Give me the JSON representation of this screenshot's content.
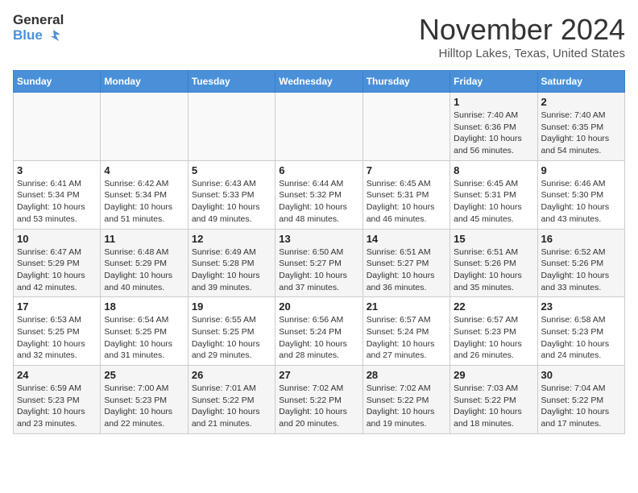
{
  "header": {
    "logo_line1": "General",
    "logo_line2": "Blue",
    "month": "November 2024",
    "location": "Hilltop Lakes, Texas, United States"
  },
  "weekdays": [
    "Sunday",
    "Monday",
    "Tuesday",
    "Wednesday",
    "Thursday",
    "Friday",
    "Saturday"
  ],
  "weeks": [
    [
      {
        "day": "",
        "info": ""
      },
      {
        "day": "",
        "info": ""
      },
      {
        "day": "",
        "info": ""
      },
      {
        "day": "",
        "info": ""
      },
      {
        "day": "",
        "info": ""
      },
      {
        "day": "1",
        "info": "Sunrise: 7:40 AM\nSunset: 6:36 PM\nDaylight: 10 hours and 56 minutes."
      },
      {
        "day": "2",
        "info": "Sunrise: 7:40 AM\nSunset: 6:35 PM\nDaylight: 10 hours and 54 minutes."
      }
    ],
    [
      {
        "day": "3",
        "info": "Sunrise: 6:41 AM\nSunset: 5:34 PM\nDaylight: 10 hours and 53 minutes."
      },
      {
        "day": "4",
        "info": "Sunrise: 6:42 AM\nSunset: 5:34 PM\nDaylight: 10 hours and 51 minutes."
      },
      {
        "day": "5",
        "info": "Sunrise: 6:43 AM\nSunset: 5:33 PM\nDaylight: 10 hours and 49 minutes."
      },
      {
        "day": "6",
        "info": "Sunrise: 6:44 AM\nSunset: 5:32 PM\nDaylight: 10 hours and 48 minutes."
      },
      {
        "day": "7",
        "info": "Sunrise: 6:45 AM\nSunset: 5:31 PM\nDaylight: 10 hours and 46 minutes."
      },
      {
        "day": "8",
        "info": "Sunrise: 6:45 AM\nSunset: 5:31 PM\nDaylight: 10 hours and 45 minutes."
      },
      {
        "day": "9",
        "info": "Sunrise: 6:46 AM\nSunset: 5:30 PM\nDaylight: 10 hours and 43 minutes."
      }
    ],
    [
      {
        "day": "10",
        "info": "Sunrise: 6:47 AM\nSunset: 5:29 PM\nDaylight: 10 hours and 42 minutes."
      },
      {
        "day": "11",
        "info": "Sunrise: 6:48 AM\nSunset: 5:29 PM\nDaylight: 10 hours and 40 minutes."
      },
      {
        "day": "12",
        "info": "Sunrise: 6:49 AM\nSunset: 5:28 PM\nDaylight: 10 hours and 39 minutes."
      },
      {
        "day": "13",
        "info": "Sunrise: 6:50 AM\nSunset: 5:27 PM\nDaylight: 10 hours and 37 minutes."
      },
      {
        "day": "14",
        "info": "Sunrise: 6:51 AM\nSunset: 5:27 PM\nDaylight: 10 hours and 36 minutes."
      },
      {
        "day": "15",
        "info": "Sunrise: 6:51 AM\nSunset: 5:26 PM\nDaylight: 10 hours and 35 minutes."
      },
      {
        "day": "16",
        "info": "Sunrise: 6:52 AM\nSunset: 5:26 PM\nDaylight: 10 hours and 33 minutes."
      }
    ],
    [
      {
        "day": "17",
        "info": "Sunrise: 6:53 AM\nSunset: 5:25 PM\nDaylight: 10 hours and 32 minutes."
      },
      {
        "day": "18",
        "info": "Sunrise: 6:54 AM\nSunset: 5:25 PM\nDaylight: 10 hours and 31 minutes."
      },
      {
        "day": "19",
        "info": "Sunrise: 6:55 AM\nSunset: 5:25 PM\nDaylight: 10 hours and 29 minutes."
      },
      {
        "day": "20",
        "info": "Sunrise: 6:56 AM\nSunset: 5:24 PM\nDaylight: 10 hours and 28 minutes."
      },
      {
        "day": "21",
        "info": "Sunrise: 6:57 AM\nSunset: 5:24 PM\nDaylight: 10 hours and 27 minutes."
      },
      {
        "day": "22",
        "info": "Sunrise: 6:57 AM\nSunset: 5:23 PM\nDaylight: 10 hours and 26 minutes."
      },
      {
        "day": "23",
        "info": "Sunrise: 6:58 AM\nSunset: 5:23 PM\nDaylight: 10 hours and 24 minutes."
      }
    ],
    [
      {
        "day": "24",
        "info": "Sunrise: 6:59 AM\nSunset: 5:23 PM\nDaylight: 10 hours and 23 minutes."
      },
      {
        "day": "25",
        "info": "Sunrise: 7:00 AM\nSunset: 5:23 PM\nDaylight: 10 hours and 22 minutes."
      },
      {
        "day": "26",
        "info": "Sunrise: 7:01 AM\nSunset: 5:22 PM\nDaylight: 10 hours and 21 minutes."
      },
      {
        "day": "27",
        "info": "Sunrise: 7:02 AM\nSunset: 5:22 PM\nDaylight: 10 hours and 20 minutes."
      },
      {
        "day": "28",
        "info": "Sunrise: 7:02 AM\nSunset: 5:22 PM\nDaylight: 10 hours and 19 minutes."
      },
      {
        "day": "29",
        "info": "Sunrise: 7:03 AM\nSunset: 5:22 PM\nDaylight: 10 hours and 18 minutes."
      },
      {
        "day": "30",
        "info": "Sunrise: 7:04 AM\nSunset: 5:22 PM\nDaylight: 10 hours and 17 minutes."
      }
    ]
  ]
}
